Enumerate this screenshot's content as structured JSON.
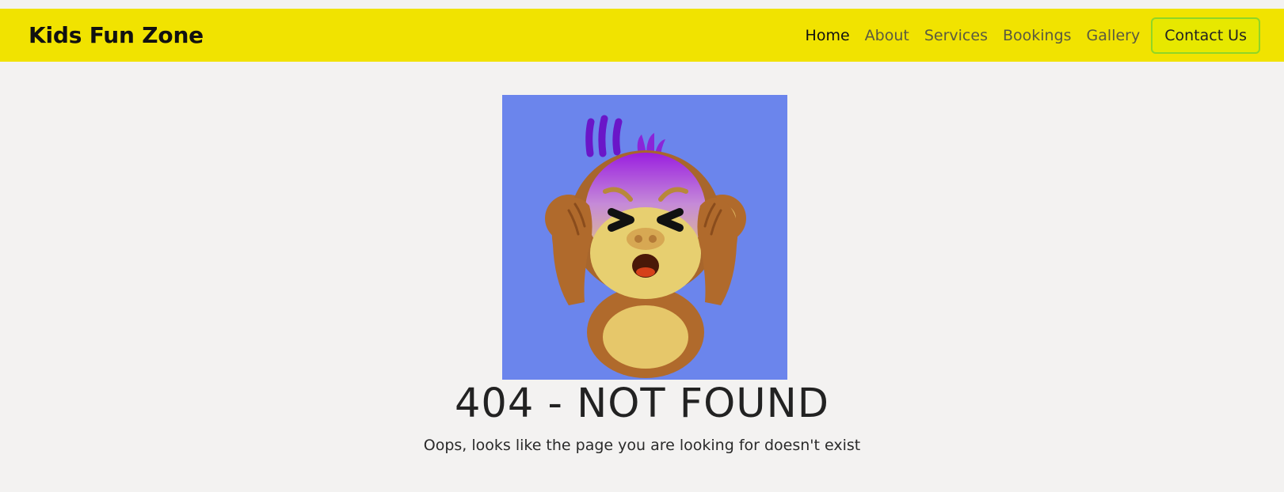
{
  "header": {
    "brand": "Kids Fun Zone",
    "nav": [
      {
        "label": "Home",
        "active": true
      },
      {
        "label": "About",
        "active": false
      },
      {
        "label": "Services",
        "active": false
      },
      {
        "label": "Bookings",
        "active": false
      },
      {
        "label": "Gallery",
        "active": false
      }
    ],
    "contact_label": "Contact Us"
  },
  "main": {
    "image_icon": "frustrated-monkey-emoji",
    "title": "404 - NOT FOUND",
    "message": "Oops, looks like the page you are looking for doesn't exist"
  },
  "colors": {
    "header_bg": "#f1e300",
    "page_bg": "#f3f2f1",
    "image_bg": "#6b85ec",
    "contact_border": "#8fd626"
  }
}
